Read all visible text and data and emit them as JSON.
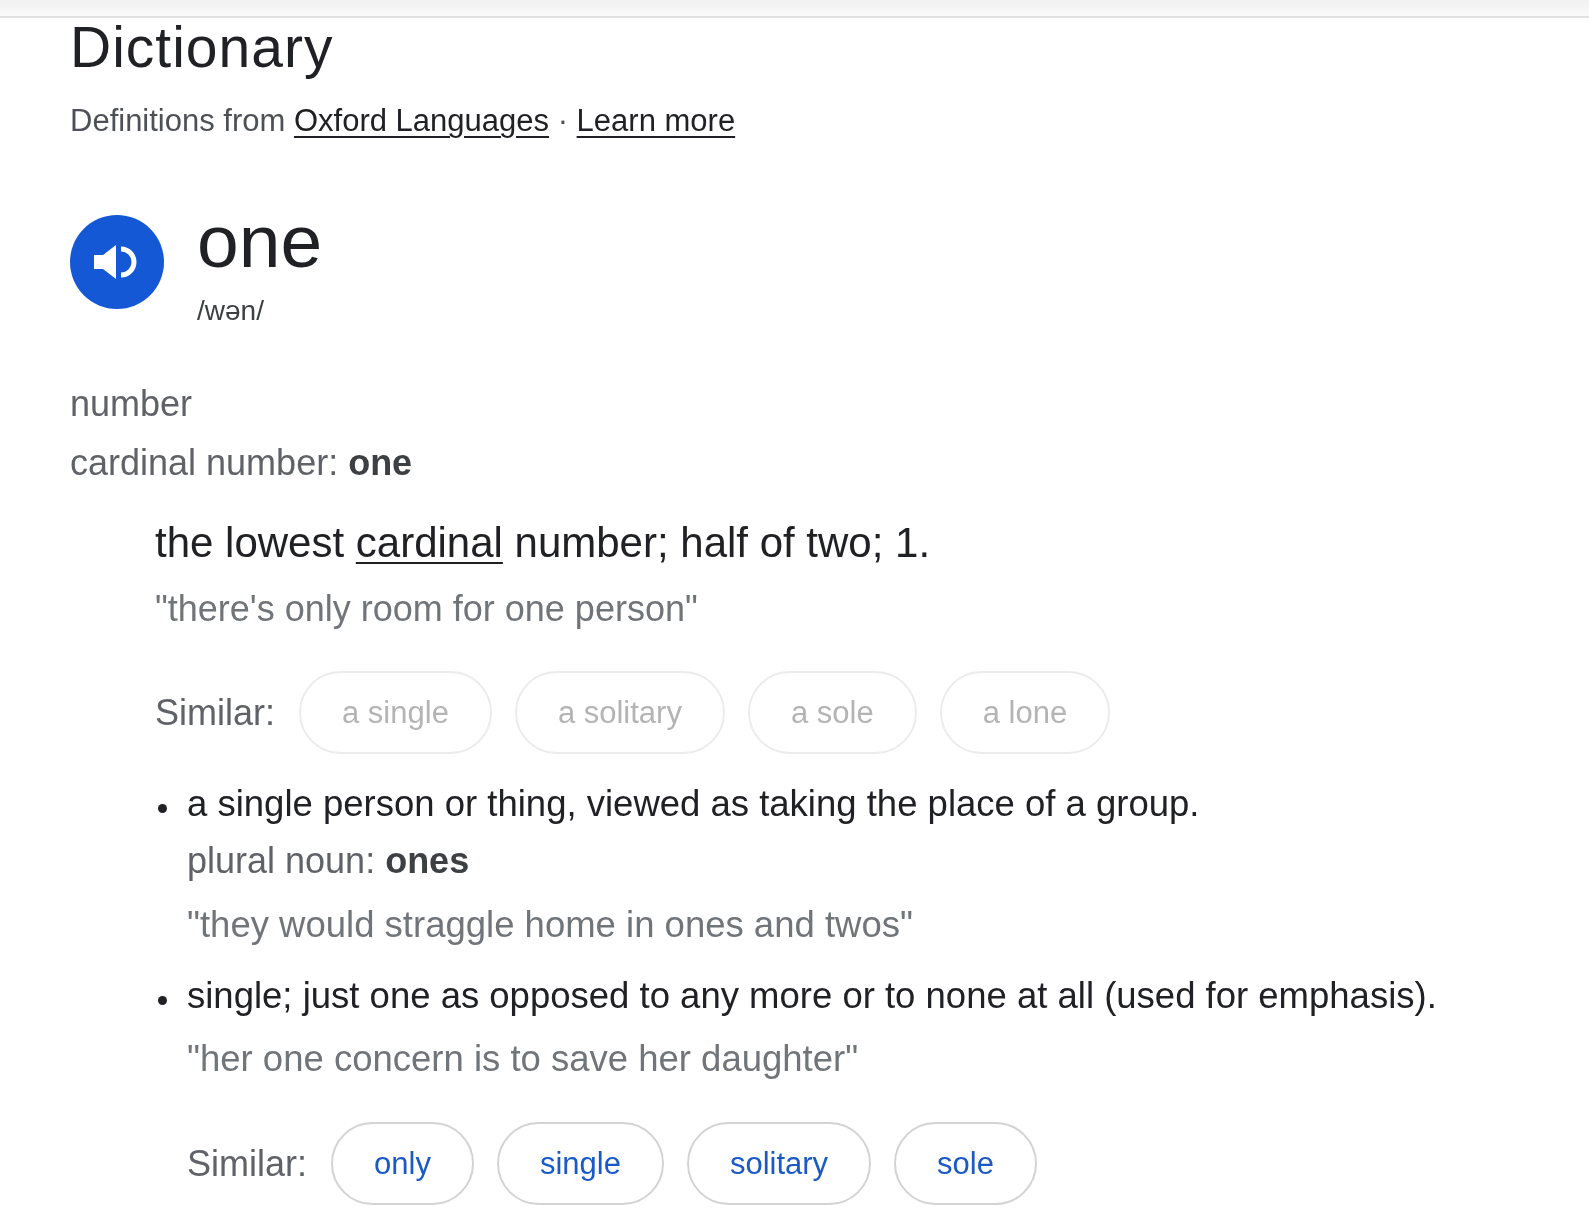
{
  "header": {
    "title": "Dictionary",
    "source": [
      {
        "text": "Definitions from ",
        "kind": "plain"
      },
      {
        "text": "Oxford Languages",
        "kind": "link"
      },
      {
        "text": " · ",
        "kind": "plain"
      },
      {
        "text": "Learn more",
        "kind": "link"
      }
    ]
  },
  "entry": {
    "word": "one",
    "pronunciation": "/wən/"
  },
  "grammar": {
    "category": "number",
    "form": "cardinal number: **one**"
  },
  "sense": {
    "definition": [
      {
        "text": "the lowest ",
        "kind": "plain"
      },
      {
        "text": "cardinal",
        "kind": "link"
      },
      {
        "text": " number; half of two; 1.",
        "kind": "plain"
      }
    ],
    "example": "\"there's only room for one person\"",
    "similar": {
      "label": "Similar:",
      "words": [
        {
          "text": "a single",
          "disabled": true
        },
        {
          "text": "a solitary",
          "disabled": true
        },
        {
          "text": "a sole",
          "disabled": true
        },
        {
          "text": "a lone",
          "disabled": true
        }
      ]
    }
  },
  "subsenses": [
    {
      "definition": "a single person or thing, viewed as taking the place of a group.",
      "grammar": "plural noun: **ones**",
      "example": "\"they would straggle home in ones and twos\""
    },
    {
      "definition": "single; just one as opposed to any more or to none at all (used for emphasis).",
      "example": "\"her one concern is to save her daughter\"",
      "similar": {
        "label": "Similar:",
        "words": [
          {
            "text": "only",
            "disabled": false
          },
          {
            "text": "single",
            "disabled": false
          },
          {
            "text": "solitary",
            "disabled": false
          },
          {
            "text": "sole",
            "disabled": false
          }
        ]
      }
    }
  ]
}
